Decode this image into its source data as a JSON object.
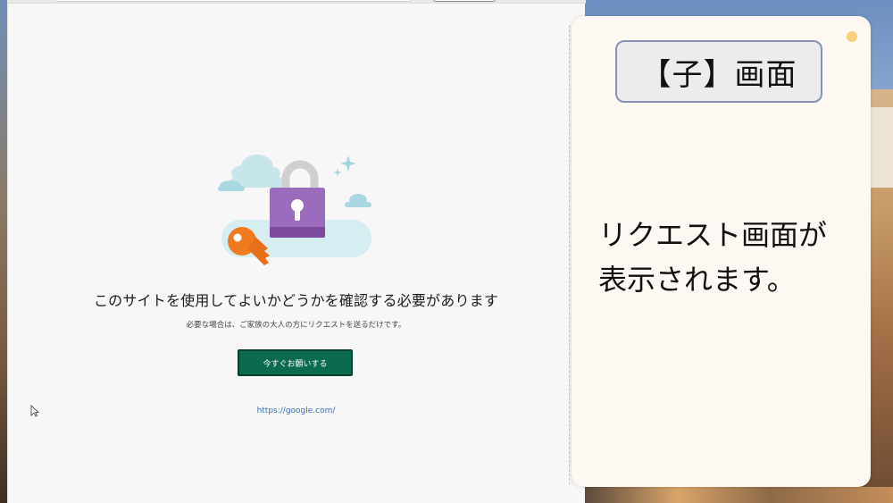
{
  "browser": {
    "heading": "このサイトを使用してよいかどうかを確認する必要があります",
    "subtext": "必要な場合は、ご家族の大人の方にリクエストを送るだけです。",
    "ask_button_label": "今すぐお願いする",
    "site_url": "https://google.com/"
  },
  "caption": {
    "title": "【子】画面",
    "line1": "リクエスト画面が",
    "line2": "表示されます。"
  },
  "colors": {
    "ask_button": "#0b6b4f",
    "link": "#3a6fb5",
    "lock_body": "#9b6bbd",
    "key": "#f07b1e",
    "cloud": "#bfe3ea",
    "title_border": "#8791c0"
  },
  "icons": [
    "padlock-icon",
    "key-icon",
    "sparkle-icon",
    "cloud-icon",
    "cursor-icon"
  ]
}
